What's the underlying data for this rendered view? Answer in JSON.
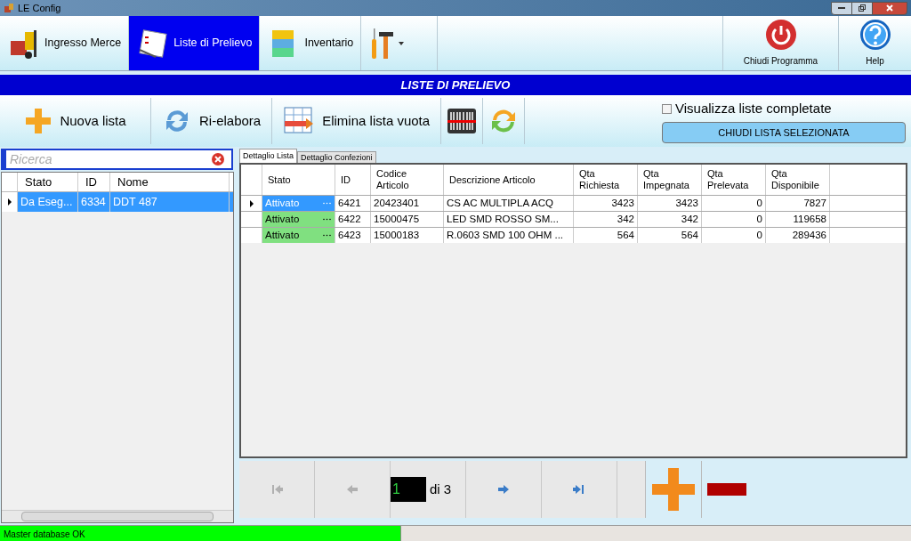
{
  "window": {
    "title": "LE Config"
  },
  "ribbon": [
    {
      "kind": "module",
      "label": "Ingresso Merce",
      "selected": false
    },
    {
      "kind": "module",
      "label": "Liste di Prelievo",
      "selected": true
    },
    {
      "kind": "module",
      "label": "Inventario",
      "selected": false
    },
    {
      "kind": "tools",
      "selected": false
    }
  ],
  "ribbon_right": [
    {
      "kind": "power",
      "label": "Chiudi Programma"
    },
    {
      "kind": "help",
      "label": "Help"
    }
  ],
  "header": "LISTE DI PRELIEVO",
  "actions": [
    {
      "kind": "plus",
      "label": "Nuova lista"
    },
    {
      "kind": "refresh",
      "label": "Ri-elabora"
    },
    {
      "kind": "table",
      "label": "Elimina lista vuota"
    },
    {
      "kind": "barcode"
    },
    {
      "kind": "sync"
    }
  ],
  "show_completed": {
    "label": "Visualizza liste completate",
    "checked": false
  },
  "close_button": "CHIUDI LISTA SELEZIONATA",
  "search": {
    "placeholder": "Ricerca"
  },
  "lists": {
    "columns": [
      "Stato",
      "ID",
      "Nome"
    ],
    "rows": [
      {
        "cells": [
          "Da Eseg...",
          "6334",
          "DDT 487"
        ],
        "selected": true
      }
    ]
  },
  "tabs": [
    {
      "label": "Dettaglio Lista",
      "selected": true
    },
    {
      "label": "Dettaglio Confezioni",
      "selected": false
    }
  ],
  "detail": {
    "columns": [
      "Stato",
      "ID",
      "Codice Articolo",
      "Descrizione Articolo",
      "Qta Richiesta",
      "Qta Impegnata",
      "Qta Prelevata",
      "Qta Disponibile"
    ],
    "rows": [
      {
        "cells": [
          "Attivato",
          "6421",
          "20423401",
          "CS AC MULTIPLA ACQ",
          "3423",
          "3423",
          "0",
          "7827"
        ],
        "selected": true
      },
      {
        "cells": [
          "Attivato",
          "6422",
          "15000475",
          "LED SMD ROSSO SM...",
          "342",
          "342",
          "0",
          "119658"
        ],
        "selected": false
      },
      {
        "cells": [
          "Attivato",
          "6423",
          "15000183",
          "R.0603 SMD 100 OHM ...",
          "564",
          "564",
          "0",
          "289436"
        ],
        "selected": false
      }
    ]
  },
  "pager": {
    "first_disabled": true,
    "prev_disabled": true,
    "next_disabled": false,
    "last_disabled": false,
    "page": "1",
    "of": "di 3"
  },
  "status": {
    "text": "Master database OK",
    "level": 0.44
  }
}
